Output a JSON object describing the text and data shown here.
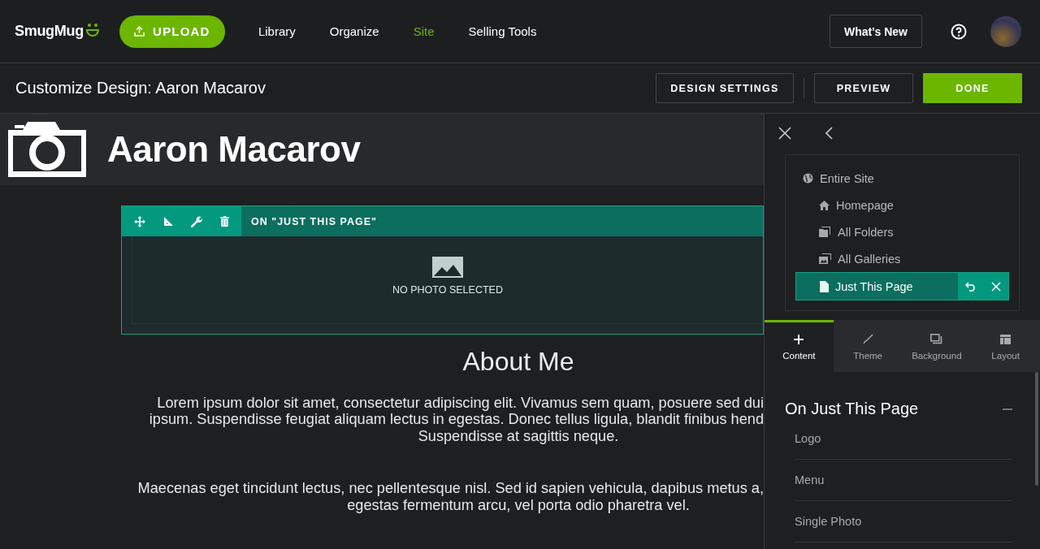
{
  "top_nav": {
    "logo": "SmugMug",
    "upload_button": "UPLOAD",
    "links": [
      {
        "label": "Library",
        "selected": false
      },
      {
        "label": "Organize",
        "selected": false
      },
      {
        "label": "Site",
        "selected": true
      },
      {
        "label": "Selling Tools",
        "selected": false
      }
    ],
    "whats_new_button": "What's New"
  },
  "toolbar": {
    "title": "Customize Design: Aaron Macarov",
    "buttons": [
      {
        "label": "DESIGN SETTINGS",
        "kind": "outline"
      },
      {
        "label": "PREVIEW",
        "kind": "outline"
      },
      {
        "label": "DONE",
        "kind": "primary"
      }
    ]
  },
  "site_header": {
    "title": "Aaron Macarov"
  },
  "photo_block": {
    "scope_label": "ON \"JUST THIS PAGE\"",
    "empty_text": "NO PHOTO SELECTED"
  },
  "about": {
    "heading": "About Me",
    "paragraphs": [
      [
        {
          "text": "Lorem ipsum dolor sit amet, consectetur adipiscing elit. Vivamus sem quam, posuere sed dui",
          "cut_off": true
        },
        {
          "text": "ipsum. Suspendisse feugiat aliquam lectus in egestas. Donec tellus ligula, blandit finibus hend",
          "cut_off": true
        },
        {
          "text": "Suspendisse at sagittis neque.",
          "cut_off": false
        }
      ],
      [
        {
          "text": "Maecenas eget tincidunt lectus, nec pellentesque nisl. Sed id sapien vehicula, dapibus metus a,",
          "cut_off": true
        },
        {
          "text": "egestas fermentum arcu, vel porta odio pharetra vel.",
          "cut_off": false
        }
      ]
    ]
  },
  "panel": {
    "scopes": [
      {
        "label": "Entire Site",
        "kind": "globe",
        "selected": false,
        "children": [
          {
            "label": "Homepage",
            "kind": "home",
            "selected": false
          },
          {
            "label": "All Folders",
            "kind": "folders",
            "selected": false
          },
          {
            "label": "All Galleries",
            "kind": "galleries",
            "selected": false
          },
          {
            "label": "Just This Page",
            "kind": "page",
            "selected": true
          }
        ]
      }
    ],
    "tabs": [
      {
        "label": "Content",
        "kind": "plus",
        "selected": true
      },
      {
        "label": "Theme",
        "kind": "brush",
        "selected": false
      },
      {
        "label": "Background",
        "kind": "background",
        "selected": false
      },
      {
        "label": "Layout",
        "kind": "layout",
        "selected": false
      }
    ],
    "section": {
      "title": "On Just This Page",
      "expanded": true,
      "items": [
        "Logo",
        "Menu",
        "Single Photo"
      ]
    }
  }
}
